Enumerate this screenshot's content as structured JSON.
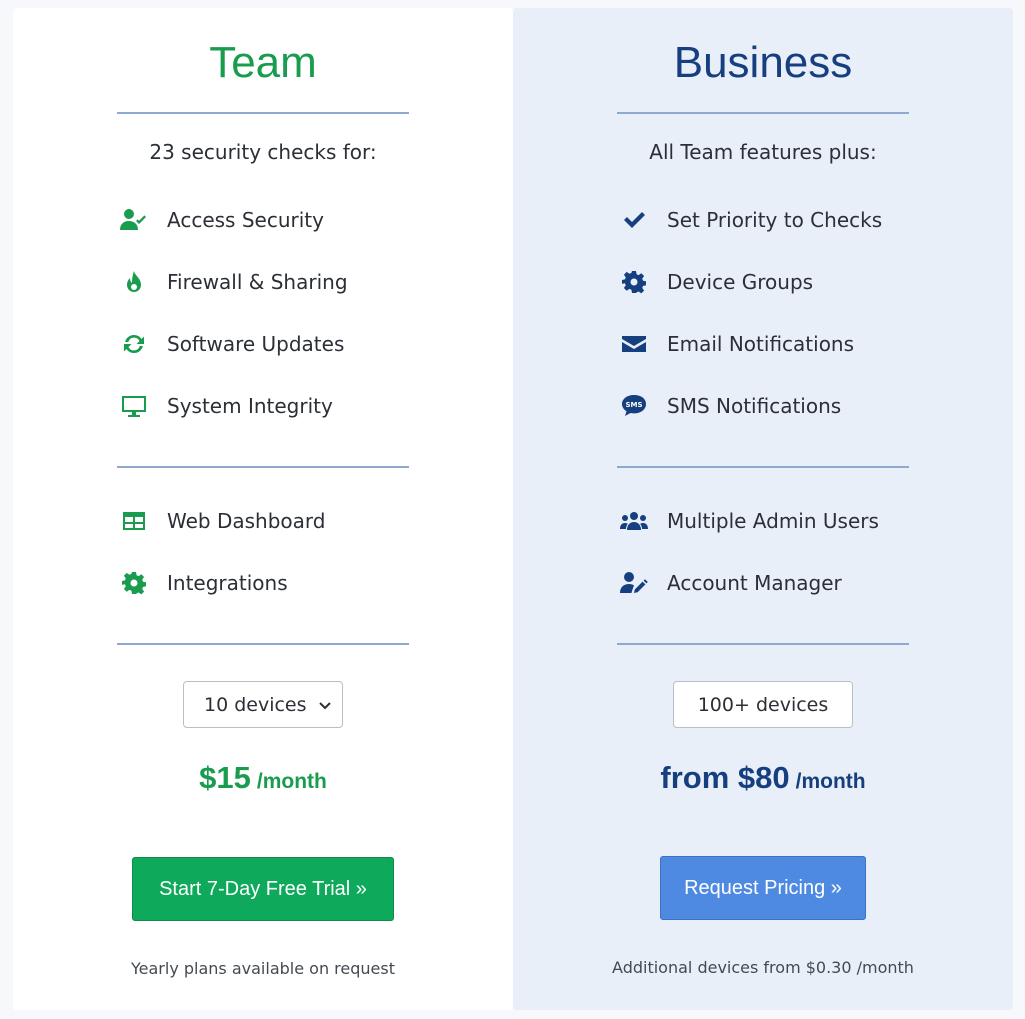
{
  "team": {
    "title": "Team",
    "intro": "23 security checks for:",
    "features_primary": [
      {
        "label": "Access Security",
        "icon": "user-check-icon"
      },
      {
        "label": "Firewall & Sharing",
        "icon": "fire-icon"
      },
      {
        "label": "Software Updates",
        "icon": "refresh-icon"
      },
      {
        "label": "System Integrity",
        "icon": "monitor-icon"
      }
    ],
    "features_secondary": [
      {
        "label": "Web Dashboard",
        "icon": "table-icon"
      },
      {
        "label": "Integrations",
        "icon": "gear-icon"
      }
    ],
    "device_select": {
      "value": "10 devices",
      "options": [
        "10 devices"
      ]
    },
    "price": {
      "amount": "$15",
      "per": "/month"
    },
    "cta_label": "Start 7-Day Free Trial »",
    "footnote": "Yearly plans available on request",
    "accent_color": "#1a9c4f",
    "button_color": "#0ea95a"
  },
  "business": {
    "title": "Business",
    "intro": "All Team features plus:",
    "features_primary": [
      {
        "label": "Set Priority to Checks",
        "icon": "checkmark-icon"
      },
      {
        "label": "Device Groups",
        "icon": "gear-icon"
      },
      {
        "label": "Email Notifications",
        "icon": "envelope-icon"
      },
      {
        "label": "SMS Notifications",
        "icon": "sms-bubble-icon"
      }
    ],
    "features_secondary": [
      {
        "label": "Multiple Admin Users",
        "icon": "users-icon"
      },
      {
        "label": "Account Manager",
        "icon": "user-edit-icon"
      }
    ],
    "devices": "100+ devices",
    "price": {
      "amount": "from $80",
      "per": "/month"
    },
    "cta_label": "Request Pricing »",
    "footnote": "Additional devices from $0.30 /month",
    "accent_color": "#163f80",
    "button_color": "#4f8ae2",
    "sms_badge": "SMS"
  }
}
